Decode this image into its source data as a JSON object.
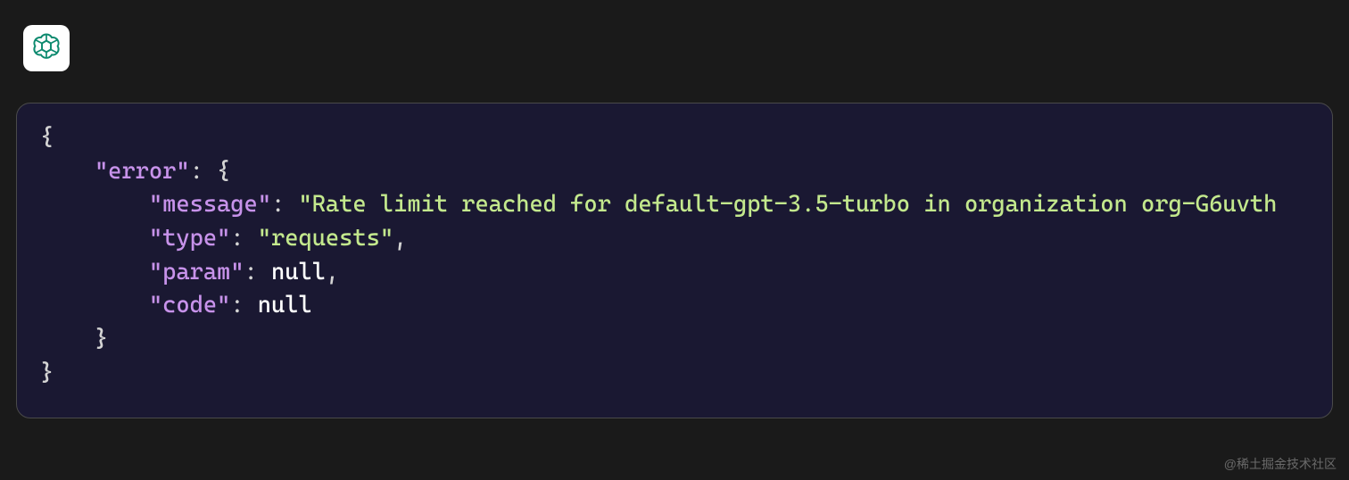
{
  "avatar": {
    "icon": "openai-icon",
    "color": "#0d8a6f"
  },
  "code": {
    "indent1": "    ",
    "indent2": "        ",
    "open_brace": "{",
    "close_brace": "}",
    "colon_space": ": ",
    "comma": ",",
    "keys": {
      "error": "\"error\"",
      "message": "\"message\"",
      "type": "\"type\"",
      "param": "\"param\"",
      "code": "\"code\""
    },
    "values": {
      "message": "\"Rate limit reached for default-gpt-3.5-turbo in organization org-G6uvth",
      "type": "\"requests\"",
      "param": "null",
      "code": "null"
    }
  },
  "watermark": "@稀土掘金技术社区"
}
